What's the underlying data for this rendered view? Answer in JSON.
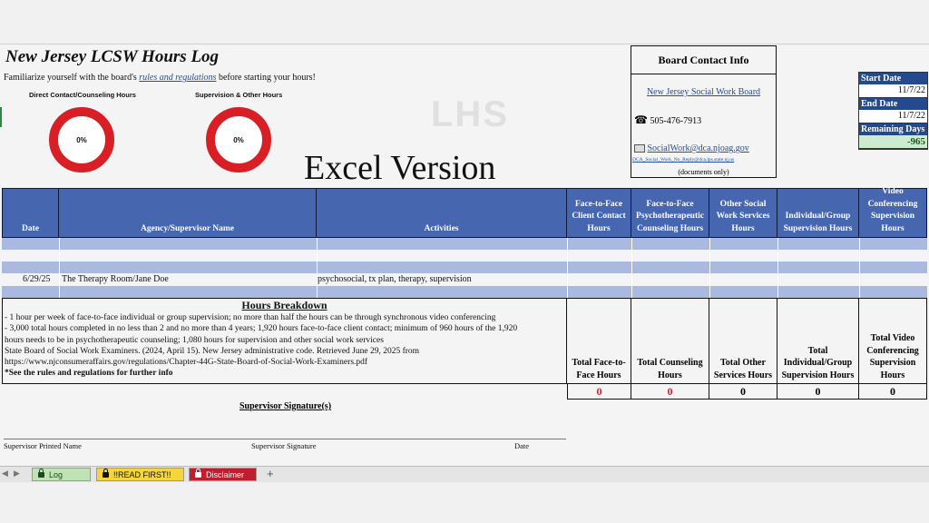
{
  "header": {
    "title": "New Jersey LCSW Hours Log",
    "subtitle_pre": "Familiarize yourself with the board's ",
    "subtitle_link": "rules and regulations",
    "subtitle_post": " before starting your hours!",
    "watermark": "LHS",
    "excel_version": "Excel Version"
  },
  "donuts": [
    {
      "label": "Direct Contact/Counseling Hours",
      "value": "0%"
    },
    {
      "label": "Supervision & Other Hours",
      "value": "0%"
    }
  ],
  "contact": {
    "heading": "Board Contact Info",
    "board_link": "New Jersey Social Work Board",
    "phone": "505-476-7913",
    "email": "SocialWork@dca.njoag.gov",
    "noreply": "DCA_Social_Work_No_Reply@dca.lps.state.nj.us",
    "note": "(documents only)"
  },
  "dates": {
    "start_label": "Start Date",
    "start_value": "11/7/22",
    "end_label": "End Date",
    "end_value": "11/7/22",
    "remaining_label": "Remaining Days",
    "remaining_value": "-965"
  },
  "table": {
    "headers": [
      "Date",
      "Agency/Supervisor Name",
      "Activities",
      "Face-to-Face Client Contact Hours",
      "Face-to-Face Psychotherapeutic Counseling Hours",
      "Other Social Work Services Hours",
      "Individual/Group Supervision Hours",
      "Video Conferencing Supervision Hours"
    ],
    "entry": {
      "date": "6/29/25",
      "agency": "The Therapy Room/Jane Doe",
      "activities": "psychosocial, tx plan, therapy, supervision"
    }
  },
  "breakdown": {
    "heading": "Hours Breakdown",
    "lines": [
      "- 1 hour per week of face-to-face individual or group supervision; no more than half the hours can be through synchronous video conferencing",
      "- 3,000 total hours completed in no less than 2 and no more than 4 years; 1,920 hours face-to-face client contact; minimum of 960 hours of the 1,920",
      "hours needs to be in psychotherapeutic counseling; 1,080 hours for supervision and other social work services",
      "State Board of Social Work Examiners. (2024, April 15). New Jersey administrative code. Retrieved June 29, 2025 from",
      "https://www.njconsumeraffairs.gov/regulations/Chapter-44G-State-Board-of-Social-Work-Examiners.pdf",
      "*See the rules and regulations for further info"
    ]
  },
  "totals": [
    {
      "label": "Total Face-to-Face Hours",
      "value": "0",
      "color": "#d81f26"
    },
    {
      "label": "Total Counseling Hours",
      "value": "0",
      "color": "#d81f26"
    },
    {
      "label": "Total Other Services Hours",
      "value": "0",
      "color": "#111111"
    },
    {
      "label": "Total Individual/Group Supervision Hours",
      "value": "0",
      "color": "#111111"
    },
    {
      "label": "Total Video Conferencing Supervision Hours",
      "value": "0",
      "color": "#111111"
    }
  ],
  "signature": {
    "title": "Supervisor Signature(s)",
    "printed_name": "Supervisor Printed Name",
    "signature": "Supervisor Signature",
    "date": "Date"
  },
  "tabs": [
    {
      "label": "Log",
      "locked": true
    },
    {
      "label": "!!READ FIRST!!",
      "locked": true
    },
    {
      "label": "Disclaimer",
      "locked": true
    },
    {
      "label": "+"
    }
  ],
  "colors": {
    "header_blue": "#4766b0",
    "accent_red": "#d81f26",
    "row_blue": "#a9b9e0",
    "remaining_green": "#cdeccf"
  }
}
